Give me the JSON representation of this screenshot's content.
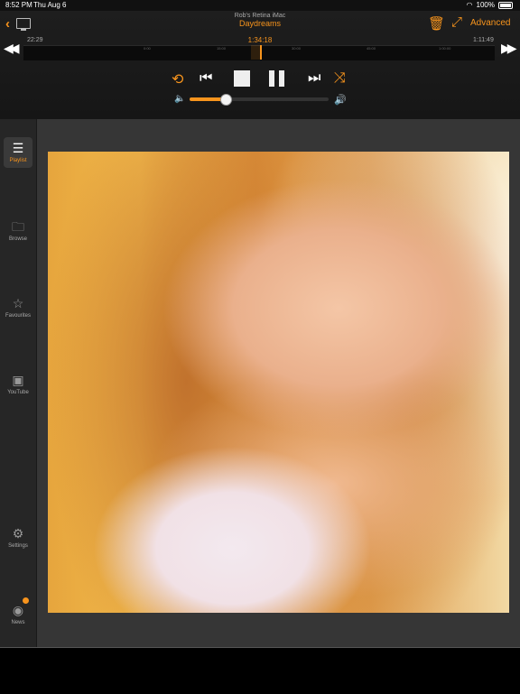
{
  "status_bar": {
    "time": "8:52 PM",
    "date": "Thu Aug 6",
    "battery": "100%"
  },
  "header": {
    "device_name": "Rob's Retina iMac",
    "track_title": "Daydreams",
    "advanced_label": "Advanced"
  },
  "timeline": {
    "elapsed": "22:29",
    "current": "1:34:18",
    "total": "1:11:49",
    "ticks": [
      "0:00",
      "15:00",
      "30:00",
      "45:00",
      "1:00:00"
    ]
  },
  "volume": {
    "level": 0.26
  },
  "sidebar": {
    "items": [
      {
        "label": "Playlist",
        "icon": "list-icon"
      },
      {
        "label": "Browse",
        "icon": "folder-icon"
      },
      {
        "label": "Favourites",
        "icon": "star-icon"
      },
      {
        "label": "YouTube",
        "icon": "youtube-icon"
      },
      {
        "label": "Settings",
        "icon": "gear-icon"
      },
      {
        "label": "News",
        "icon": "rss-icon"
      }
    ]
  },
  "colors": {
    "accent": "#f7941d",
    "panel": "#363636",
    "sidebar": "#262626"
  }
}
